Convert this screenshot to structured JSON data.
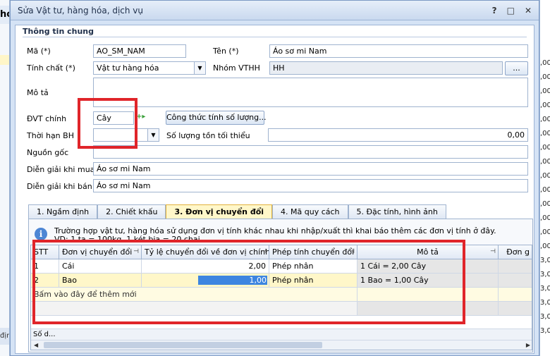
{
  "background": {
    "left_header": "hó",
    "left_footer": "địn",
    "right_values": [
      ",00",
      ",00",
      ",00",
      ",00",
      ",00",
      ",00",
      ",00",
      ",00",
      ",00",
      ",00",
      ",00",
      ",00",
      ",00",
      ",00",
      "3,00",
      "3,00",
      "3,00",
      "3,00",
      "3,00",
      "3,00"
    ]
  },
  "dialog": {
    "title": "Sửa Vật tư, hàng hóa, dịch vụ",
    "help_button": "?",
    "minimize_button": "□",
    "close_button": "✕"
  },
  "general": {
    "group_title": "Thông tin chung",
    "code_label": "Mã (*)",
    "code_value": "AO_SM_NAM",
    "name_label": "Tên (*)",
    "name_value": "Áo sơ mi Nam",
    "nature_label": "Tính chất (*)",
    "nature_value": "Vật tư hàng hóa",
    "group_label": "Nhóm VTHH",
    "group_value": "HH",
    "group_browse": "...",
    "description_label": "Mô tả",
    "description_value": "",
    "unit_label": "ĐVT chính",
    "unit_value": "Cây",
    "formula_button": "Công thức tính số lượng...",
    "warranty_label": "Thời hạn BH",
    "warranty_value": "",
    "min_stock_label": "Số lượng tồn tối thiểu",
    "min_stock_value": "0,00",
    "origin_label": "Nguồn gốc",
    "origin_value": "",
    "purchase_desc_label": "Diễn giải khi mua",
    "purchase_desc_value": "Áo sơ mi Nam",
    "sale_desc_label": "Diễn giải khi bán",
    "sale_desc_value": "Áo sơ mi Nam"
  },
  "tabs": [
    {
      "label": "1. Ngầm định",
      "active": false
    },
    {
      "label": "2. Chiết khấu",
      "active": false
    },
    {
      "label": "3. Đơn vị chuyển đổi",
      "active": true
    },
    {
      "label": "4. Mã quy cách",
      "active": false
    },
    {
      "label": "5. Đặc tính, hình ảnh",
      "active": false
    }
  ],
  "conversion": {
    "info_line1": "Trường hợp vật tư, hàng hóa sử dụng đơn vị tính khác nhau khi nhập/xuất thì khai báo thêm các đơn vị tính ở đây.",
    "info_line2": "VD: 1 tạ = 100kg, 1 két bia = 20 chai",
    "columns": [
      "STT",
      "Đơn vị chuyển đổi",
      "Tỷ lệ chuyển đổi về đơn vị chính",
      "Phép tính chuyển đổi",
      "Mô tả",
      "Đơn g"
    ],
    "rows": [
      {
        "stt": "1",
        "unit": "Cái",
        "ratio": "2,00",
        "operation": "Phép nhân",
        "description": "1 Cái = 2,00 Cây"
      },
      {
        "stt": "2",
        "unit": "Bao",
        "ratio": "1,00",
        "operation": "Phép nhân",
        "description": "1 Bao = 1,00 Cây"
      }
    ],
    "add_row_hint": "Bấm vào đây để thêm mới",
    "footer_label": "Số d..."
  }
}
